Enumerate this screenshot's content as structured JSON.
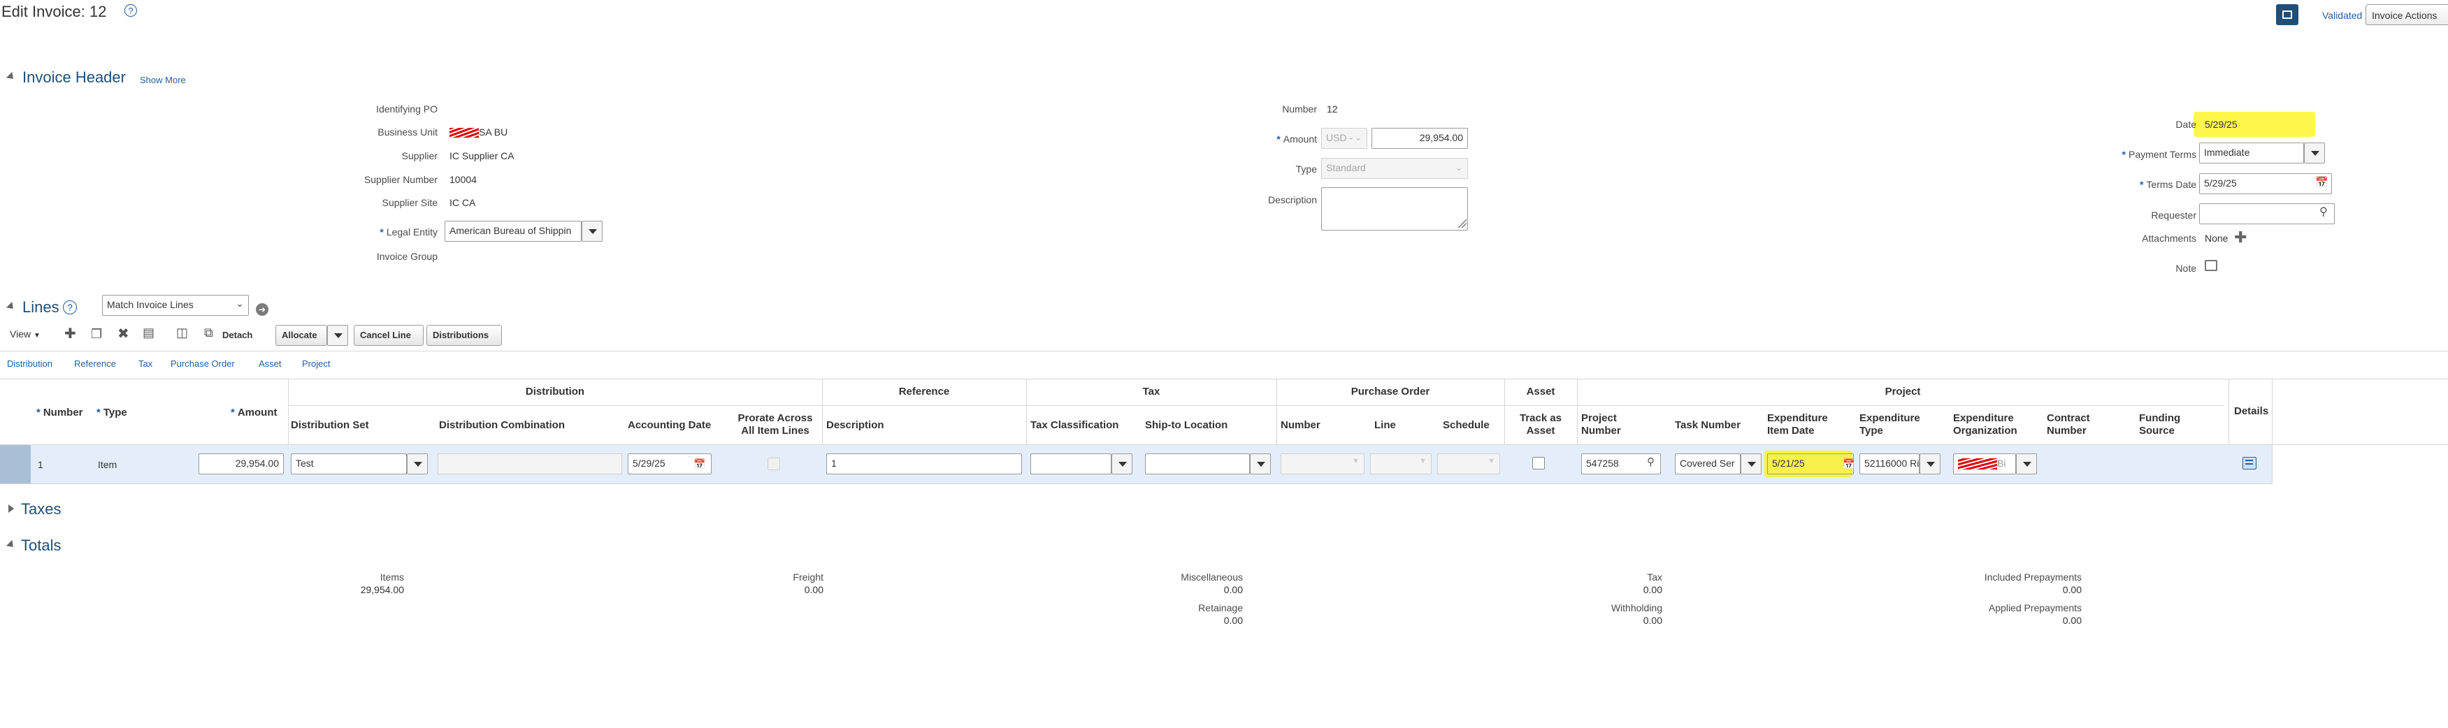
{
  "page": {
    "title": "Edit Invoice: 12",
    "status": "Validated",
    "actions_label": "Invoice Actions"
  },
  "header": {
    "title": "Invoice Header",
    "show_more": "Show More",
    "identifying_po_label": "Identifying PO",
    "business_unit_label": "Business Unit",
    "business_unit_value": "SA BU",
    "supplier_label": "Supplier",
    "supplier_value": "IC Supplier CA",
    "supplier_number_label": "Supplier Number",
    "supplier_number_value": "10004",
    "supplier_site_label": "Supplier Site",
    "supplier_site_value": "IC CA",
    "legal_entity_label": "Legal Entity",
    "legal_entity_value": "American Bureau of Shippin",
    "invoice_group_label": "Invoice Group",
    "number_label": "Number",
    "number_value": "12",
    "amount_label": "Amount",
    "currency_value": "USD -",
    "amount_value": "29,954.00",
    "type_label": "Type",
    "type_value": "Standard",
    "description_label": "Description",
    "date_label": "Date",
    "date_value": "5/29/25",
    "payment_terms_label": "Payment Terms",
    "payment_terms_value": "Immediate",
    "terms_date_label": "Terms Date",
    "terms_date_value": "5/29/25",
    "requester_label": "Requester",
    "attachments_label": "Attachments",
    "attachments_value": "None",
    "note_label": "Note"
  },
  "lines": {
    "title": "Lines",
    "match_select_value": "Match Invoice Lines",
    "view_label": "View",
    "detach_label": "Detach",
    "allocate_label": "Allocate",
    "cancel_line_label": "Cancel Line",
    "distributions_label": "Distributions",
    "tabs": [
      "Distribution",
      "Reference",
      "Tax",
      "Purchase Order",
      "Asset",
      "Project"
    ],
    "groups": {
      "distribution": "Distribution",
      "reference": "Reference",
      "tax": "Tax",
      "purchase_order": "Purchase Order",
      "asset": "Asset",
      "project": "Project"
    },
    "columns": {
      "number": "Number",
      "type": "Type",
      "amount": "Amount",
      "distribution_set": "Distribution Set",
      "distribution_combination": "Distribution Combination",
      "accounting_date": "Accounting Date",
      "prorate_1": "Prorate Across",
      "prorate_2": "All Item Lines",
      "description": "Description",
      "tax_classification": "Tax Classification",
      "ship_to_location": "Ship-to Location",
      "po_number": "Number",
      "po_line": "Line",
      "po_schedule": "Schedule",
      "track_asset_1": "Track as",
      "track_asset_2": "Asset",
      "project_number_1": "Project",
      "project_number_2": "Number",
      "task_number": "Task Number",
      "exp_item_date_1": "Expenditure",
      "exp_item_date_2": "Item Date",
      "exp_type_1": "Expenditure",
      "exp_type_2": "Type",
      "exp_org_1": "Expenditure",
      "exp_org_2": "Organization",
      "contract_number_1": "Contract",
      "contract_number_2": "Number",
      "funding_source_1": "Funding",
      "funding_source_2": "Source",
      "details": "Details"
    },
    "row": {
      "number": "1",
      "type": "Item",
      "amount": "29,954.00",
      "distribution_set": "Test",
      "accounting_date": "5/29/25",
      "description": "1",
      "project_number": "547258",
      "task_number": "Covered Ser",
      "exp_item_date": "5/21/25",
      "exp_type": "52116000 Ri",
      "exp_org": "Bi"
    }
  },
  "taxes": {
    "title": "Taxes"
  },
  "totals": {
    "title": "Totals",
    "items_label": "Items",
    "items_value": "29,954.00",
    "freight_label": "Freight",
    "freight_value": "0.00",
    "misc_label": "Miscellaneous",
    "misc_value": "0.00",
    "retainage_label": "Retainage",
    "retainage_value": "0.00",
    "tax_label": "Tax",
    "tax_value": "0.00",
    "withholding_label": "Withholding",
    "withholding_value": "0.00",
    "included_prepayments_label": "Included Prepayments",
    "included_prepayments_value": "0.00",
    "applied_prepayments_label": "Applied Prepayments",
    "applied_prepayments_value": "0.00"
  },
  "colors": {
    "accent": "#1f5fa8",
    "highlight": "#fff200",
    "selected_row": "#e3eefa",
    "redaction": "#e00000"
  }
}
